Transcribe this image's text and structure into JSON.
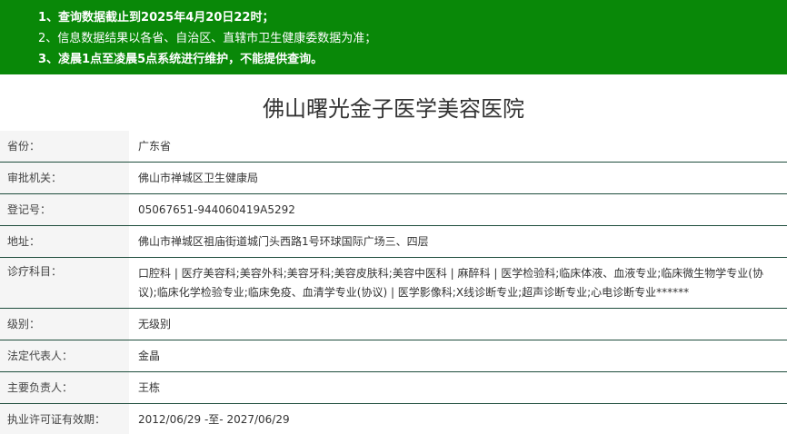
{
  "notice": {
    "line1": "1、查询数据截止到2025年4月20日22时；",
    "line2": "2、信息数据结果以各省、自治区、直辖市卫生健康委数据为准；",
    "line3": "3、凌晨1点至凌晨5点系统进行维护，不能提供查询。",
    "background_color": "#098808"
  },
  "title": "佛山曙光金子医学美容医院",
  "rows": [
    {
      "label": "省份：",
      "value": "广东省"
    },
    {
      "label": "审批机关：",
      "value": "佛山市禅城区卫生健康局"
    },
    {
      "label": "登记号：",
      "value": "05067651-944060419A5292"
    },
    {
      "label": "地址：",
      "value": "佛山市禅城区祖庙街道城门头西路1号环球国际广场三、四层"
    },
    {
      "label": "诊疗科目：",
      "value": "口腔科 | 医疗美容科;美容外科;美容牙科;美容皮肤科;美容中医科 | 麻醉科 | 医学检验科;临床体液、血液专业;临床微生物学专业(协议);临床化学检验专业;临床免疫、血清学专业(协议) | 医学影像科;X线诊断专业;超声诊断专业;心电诊断专业******"
    },
    {
      "label": "级别：",
      "value": "无级别"
    },
    {
      "label": "法定代表人：",
      "value": "金晶"
    },
    {
      "label": "主要负责人：",
      "value": "王栋"
    },
    {
      "label": "执业许可证有效期：",
      "value": "2012/06/29 -至- 2027/06/29"
    }
  ]
}
